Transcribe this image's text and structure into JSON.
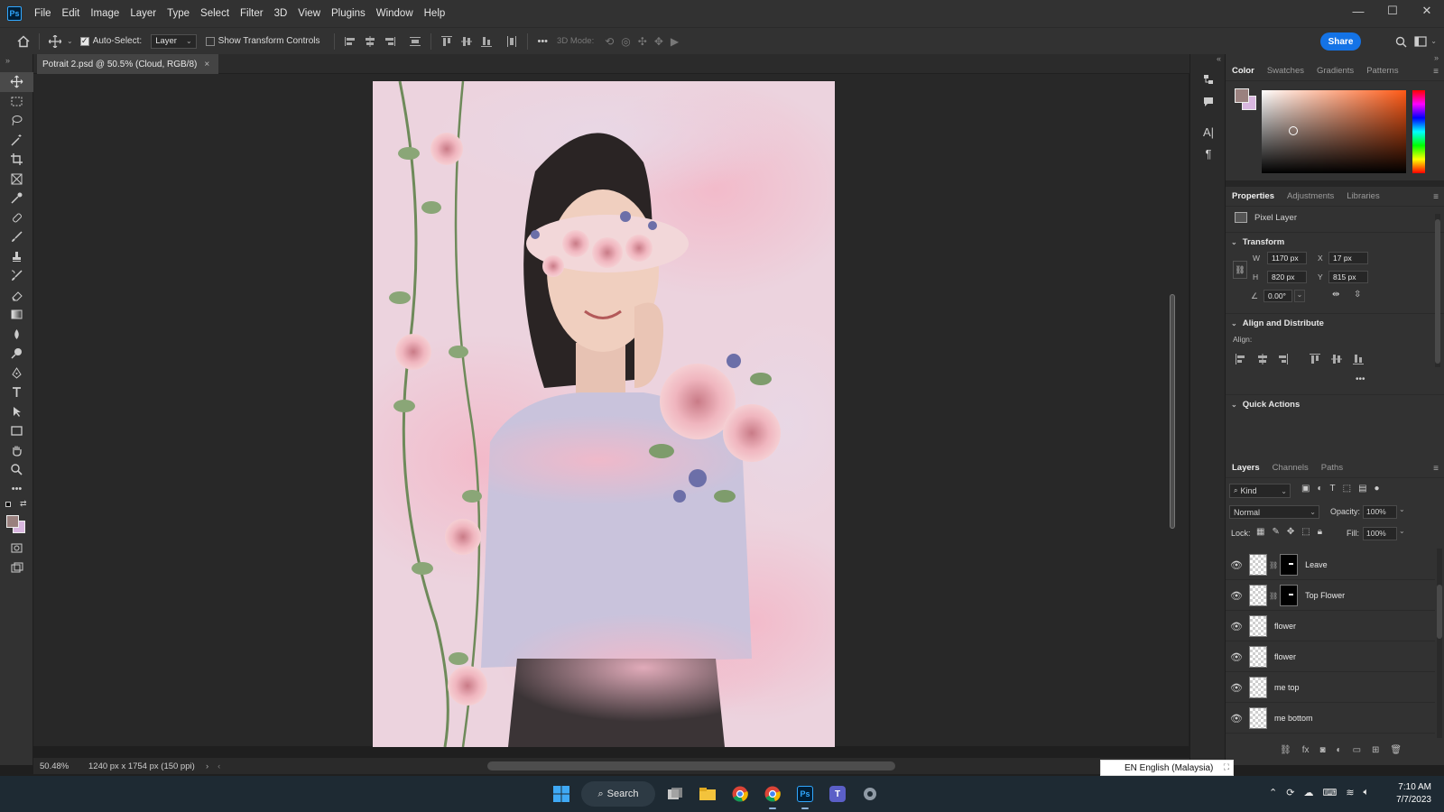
{
  "app": {
    "logo": "Ps",
    "menu": [
      "File",
      "Edit",
      "Image",
      "Layer",
      "Type",
      "Select",
      "Filter",
      "3D",
      "View",
      "Plugins",
      "Window",
      "Help"
    ],
    "window_controls": {
      "minimize": "—",
      "maximize": "☐",
      "close": "✕"
    }
  },
  "options_bar": {
    "auto_select_label": "Auto-Select:",
    "auto_select_checked": true,
    "target_value": "Layer",
    "show_transform_label": "Show Transform Controls",
    "show_transform_checked": false,
    "more": "•••",
    "mode_3d_label": "3D Mode:",
    "share_label": "Share"
  },
  "document": {
    "tab_title": "Potrait 2.psd @ 50.5% (Cloud, RGB/8)",
    "tab_close": "×"
  },
  "status_bar": {
    "zoom": "50.48%",
    "doc_info": "1240 px x 1754 px (150 ppi)",
    "arrow": "›"
  },
  "color_panel": {
    "tabs": [
      "Color",
      "Swatches",
      "Gradients",
      "Patterns"
    ],
    "active_tab": "Color",
    "foreground": "#9a817f",
    "background": "#d9b7e0"
  },
  "properties_panel": {
    "tabs": [
      "Properties",
      "Adjustments",
      "Libraries"
    ],
    "active_tab": "Properties",
    "layer_type": "Pixel Layer",
    "transform": {
      "title": "Transform",
      "w_label": "W",
      "w": "1170 px",
      "h_label": "H",
      "h": "820 px",
      "x_label": "X",
      "x": "17 px",
      "y_label": "Y",
      "y": "815 px",
      "angle": "0.00°"
    },
    "align": {
      "title": "Align and Distribute",
      "label": "Align:",
      "more": "•••"
    },
    "quick_actions": {
      "title": "Quick Actions"
    }
  },
  "layers_panel": {
    "tabs": [
      "Layers",
      "Channels",
      "Paths"
    ],
    "active_tab": "Layers",
    "filter_label": "Kind",
    "blend_mode": "Normal",
    "opacity_label": "Opacity:",
    "opacity": "100%",
    "lock_label": "Lock:",
    "fill_label": "Fill:",
    "fill": "100%",
    "layers": [
      {
        "name": "Leave",
        "has_mask": true
      },
      {
        "name": "Top Flower",
        "has_mask": true
      },
      {
        "name": "flower",
        "has_mask": false
      },
      {
        "name": "flower",
        "has_mask": false
      },
      {
        "name": "me top",
        "has_mask": false
      },
      {
        "name": "me bottom",
        "has_mask": false
      }
    ]
  },
  "taskbar": {
    "search_label": "Search",
    "language_popup": "EN English (Malaysia)",
    "time": "7:10 AM",
    "date": "7/7/2023"
  }
}
